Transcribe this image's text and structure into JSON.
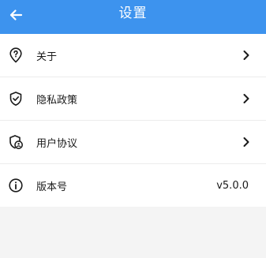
{
  "header": {
    "title": "设置",
    "back_icon": "arrow-left-icon",
    "background": "#3d93ee"
  },
  "settings": [
    {
      "label": "关于",
      "icon": "location-question-icon",
      "trailing": "chevron-right-icon"
    },
    {
      "label": "隐私政策",
      "icon": "shield-check-icon",
      "trailing": "chevron-right-icon"
    },
    {
      "label": "用户协议",
      "icon": "shield-user-icon",
      "trailing": "chevron-right-icon"
    },
    {
      "label": "版本号",
      "icon": "info-circle-icon",
      "value": "v5.0.0"
    }
  ]
}
